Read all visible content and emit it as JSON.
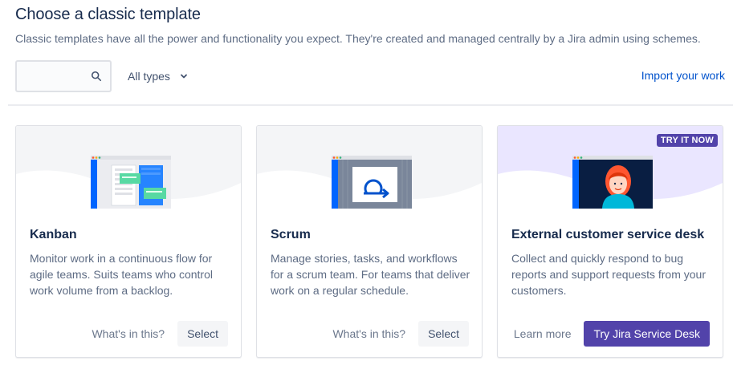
{
  "header": {
    "title": "Choose a classic template",
    "subtitle": "Classic templates have all the power and functionality you expect. They're created and managed centrally by a Jira admin using schemes."
  },
  "filters": {
    "search_value": "",
    "search_icon": "search-icon",
    "type_select": "All types",
    "type_icon": "chevron-down-icon",
    "import_link": "Import your work"
  },
  "colors": {
    "primary": "#5243aa",
    "link": "#0052cc",
    "hero_default": "#f4f5f7",
    "hero_highlight": "#eae6ff"
  },
  "cards": [
    {
      "title": "Kanban",
      "description": "Monitor work in a continuous flow for agile teams. Suits teams who control work volume from a backlog.",
      "secondary_action": "What's in this?",
      "primary_action": "Select",
      "illustration": "kanban-board-illustration"
    },
    {
      "title": "Scrum",
      "description": "Manage stories, tasks, and workflows for a scrum team. For teams that deliver work on a regular schedule.",
      "secondary_action": "What's in this?",
      "primary_action": "Select",
      "illustration": "scrum-cycle-illustration"
    },
    {
      "title": "External customer service desk",
      "description": "Collect and quickly respond to bug reports and support requests from your customers.",
      "secondary_action": "Learn more",
      "primary_action": "Try Jira Service Desk",
      "illustration": "customer-agent-illustration",
      "badge": "TRY IT NOW"
    }
  ]
}
